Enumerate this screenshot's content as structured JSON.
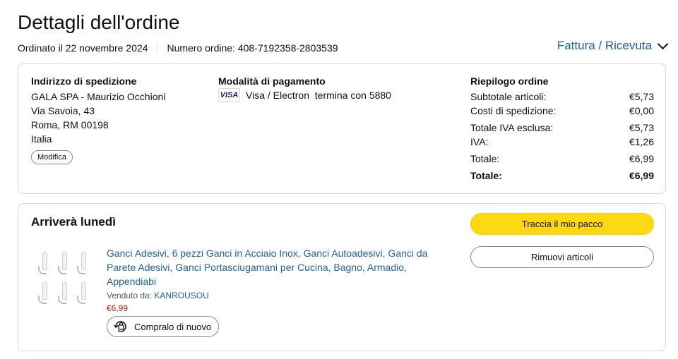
{
  "page": {
    "title": "Dettagli dell'ordine",
    "ordered_on": "Ordinato il 22 novembre 2024",
    "order_number": "Numero ordine: 408-7192358-2803539",
    "invoice_link": "Fattura / Ricevuta"
  },
  "shipping": {
    "heading": "Indirizzo di spedizione",
    "lines": [
      "GALA SPA - Maurizio Occhioni",
      "Via Savoia, 43",
      "Roma, RM 00198",
      "Italia"
    ],
    "edit_label": "Modifica"
  },
  "payment": {
    "heading": "Modalità di pagamento",
    "card_logo": "VISA",
    "card_text": "Visa / Electron  termina con 5880"
  },
  "summary": {
    "heading": "Riepilogo ordine",
    "rows": [
      {
        "label": "Subtotale articoli:",
        "value": "€5,73"
      },
      {
        "label": "Costi di spedizione:",
        "value": "€0,00"
      },
      {
        "label": "Totale IVA esclusa:",
        "value": "€5,73"
      },
      {
        "label": "IVA:",
        "value": "€1,26"
      },
      {
        "label": "Totale:",
        "value": "€6,99"
      },
      {
        "label": "Totale:",
        "value": "€6,99"
      }
    ]
  },
  "shipment": {
    "arrival": "Arriverà lunedì",
    "track_button": "Traccia il mio pacco",
    "remove_button": "Rimuovi articoli",
    "product_name": "Ganci Adesivi, 6 pezzi Ganci in Acciaio Inox, Ganci Autoadesivi, Ganci da Parete Adesivi, Ganci Portasciugamani per Cucina, Bagno, Armadio, Appendiabi",
    "sold_by_label": "Venduto da:",
    "seller": "KANROUSOU",
    "price": "€6,99",
    "buy_again": "Compralo di nuovo"
  },
  "colors": {
    "link": "#2162a1",
    "price": "#b12704",
    "track_button_bg": "#ffd814"
  }
}
